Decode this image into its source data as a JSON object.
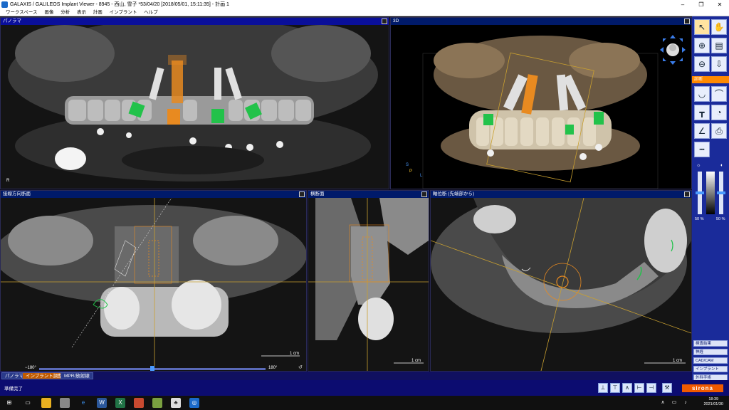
{
  "window": {
    "title": "GALAXIS / GALILEOS Implant Viewer - 8945 - 西山, 雪子 *53/04/20 [2018/05/01, 15:11:35] - 計画 1",
    "minimize": "‒",
    "maximize": "❐",
    "close": "✕"
  },
  "menu": [
    "ワークスペース",
    "画像",
    "分析",
    "表示",
    "計画",
    "インプラント",
    "ヘルプ"
  ],
  "panels": {
    "panorama": {
      "title": "パノラマ",
      "orientation": "R"
    },
    "view3d": {
      "title": "3D",
      "axis_s": "S",
      "axis_p": "P",
      "axis_l": "L"
    },
    "tangential": {
      "title": "接線方向断面",
      "scale": "1 cm",
      "angle_min": "−180°",
      "angle_max": "180°",
      "slider_fraction": 0.5
    },
    "crosssection": {
      "title": "横断面",
      "scale": "1 cm"
    },
    "axial": {
      "title": "軸位断 (先端部から)",
      "scale": "1 cm"
    }
  },
  "tabs": [
    "パノラマ",
    "インプラント調整",
    "MPR/放射線"
  ],
  "active_tab": 1,
  "sidebar": {
    "section": "診断",
    "contrast_left": "50 %",
    "contrast_right": "50 %",
    "buttons": [
      "検査結果",
      "神経",
      "CAD/CAM",
      "インプラント",
      "外科手術"
    ]
  },
  "status": {
    "text": "準備完了",
    "brand": "sirona"
  },
  "clock": {
    "time": "18:39",
    "date": "2021/01/30"
  },
  "colors": {
    "accent": "#ff8a00",
    "panel_header": "#001a6a",
    "implant_green": "#22c24a",
    "implant_orange": "#e88a20"
  }
}
